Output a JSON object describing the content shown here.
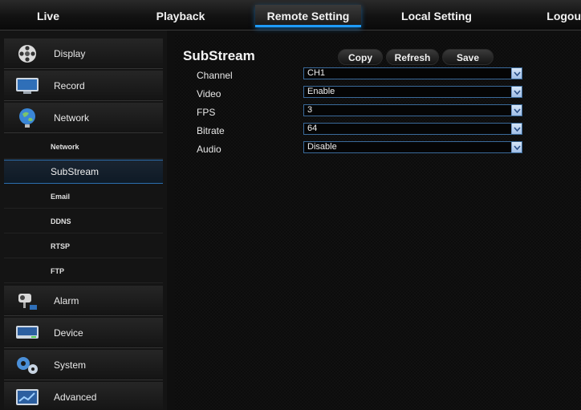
{
  "top_nav": {
    "tabs": [
      {
        "label": "Live"
      },
      {
        "label": "Playback"
      },
      {
        "label": "Remote Setting"
      },
      {
        "label": "Local Setting"
      },
      {
        "label": "Logout"
      }
    ],
    "active_tab": "Remote Setting"
  },
  "sidebar": {
    "categories": [
      {
        "label": "Display",
        "icon": "film-reel-icon"
      },
      {
        "label": "Record",
        "icon": "monitor-icon"
      },
      {
        "label": "Network",
        "icon": "globe-icon"
      },
      {
        "label": "Alarm",
        "icon": "camera-alarm-icon"
      },
      {
        "label": "Device",
        "icon": "hard-drive-icon"
      },
      {
        "label": "System",
        "icon": "gears-icon"
      },
      {
        "label": "Advanced",
        "icon": "chart-screen-icon"
      }
    ],
    "network_subitems": [
      {
        "label": "Network"
      },
      {
        "label": "SubStream"
      },
      {
        "label": "Email"
      },
      {
        "label": "DDNS"
      },
      {
        "label": "RTSP"
      },
      {
        "label": "FTP"
      }
    ],
    "active_subitem": "SubStream"
  },
  "main": {
    "title": "SubStream",
    "buttons": {
      "copy": "Copy",
      "refresh": "Refresh",
      "save": "Save"
    },
    "fields": [
      {
        "label": "Channel",
        "value": "CH1"
      },
      {
        "label": "Video",
        "value": "Enable"
      },
      {
        "label": "FPS",
        "value": "3"
      },
      {
        "label": "Bitrate",
        "value": "64"
      },
      {
        "label": "Audio",
        "value": "Disable"
      }
    ]
  },
  "colors": {
    "accent_blue": "#1e9bff",
    "select_border": "#3a6a9a",
    "background": "#0f0f0f"
  }
}
